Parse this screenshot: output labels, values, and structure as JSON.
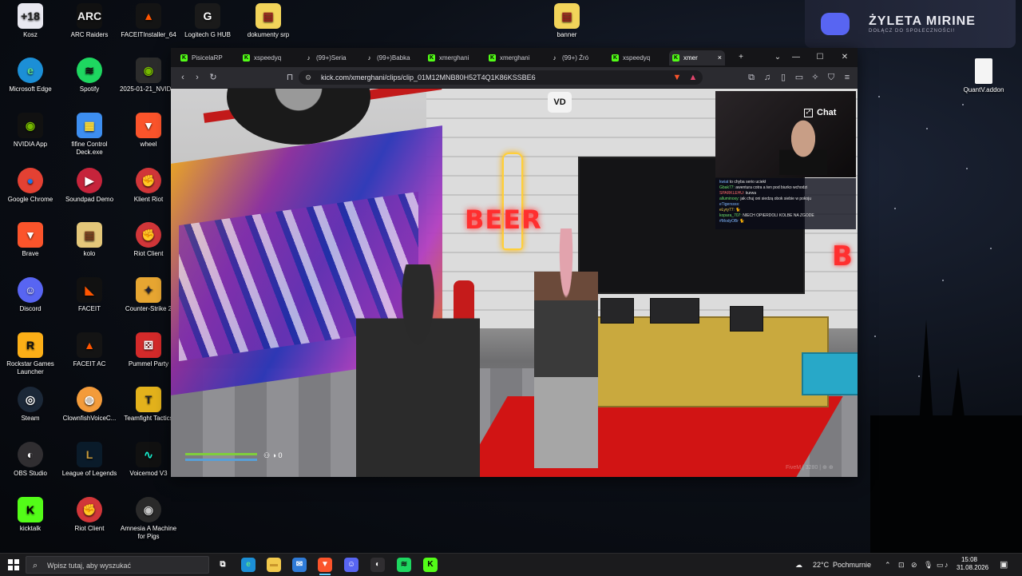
{
  "desktop": {
    "icons": [
      {
        "label": "Kosz",
        "icon": "recycle-bin-icon",
        "glyph": "+18",
        "bg": "#e8e8f0",
        "fg": "#222"
      },
      {
        "label": "ARC Raiders",
        "icon": "arc-raiders-icon",
        "glyph": "ARC",
        "bg": "#111",
        "fg": "#f0f0f0"
      },
      {
        "label": "FACEITInstaller_64",
        "icon": "faceit-installer-icon",
        "glyph": "▲",
        "bg": "#141414",
        "fg": "#ff5500"
      },
      {
        "label": "Logitech G HUB",
        "icon": "logitech-icon",
        "glyph": "G",
        "bg": "#1a1a1a",
        "fg": "#fff"
      },
      {
        "label": "dokumenty srp",
        "icon": "archive-icon",
        "glyph": "▤",
        "bg": "#f2d45a",
        "fg": "#9b1d1d"
      },
      {
        "label": "banner",
        "icon": "archive-icon",
        "glyph": "▤",
        "bg": "#f2d45a",
        "fg": "#9b1d1d"
      },
      {
        "label": "Microsoft Edge",
        "icon": "edge-icon",
        "glyph": "e",
        "bg": "#1c8fd6",
        "fg": "#5ee08a"
      },
      {
        "label": "Spotify",
        "icon": "spotify-icon",
        "glyph": "≋",
        "bg": "#1ed760",
        "fg": "#111"
      },
      {
        "label": "2025-01-21_NVIDIA",
        "icon": "nvidia-file-icon",
        "glyph": "◉",
        "bg": "#2c2c2c",
        "fg": "#76b900"
      },
      {
        "label": "NVIDIA App",
        "icon": "nvidia-icon",
        "glyph": "◉",
        "bg": "#111",
        "fg": "#76b900"
      },
      {
        "label": "fifine Control Deck.exe",
        "icon": "control-deck-icon",
        "glyph": "▦",
        "bg": "#3d8ef0",
        "fg": "#ffde3b"
      },
      {
        "label": "wheel",
        "icon": "brave-icon",
        "glyph": "▼",
        "bg": "#fb542b",
        "fg": "#fff"
      },
      {
        "label": "Google Chrome",
        "icon": "chrome-icon",
        "glyph": "●",
        "bg": "#e34133",
        "fg": "#1a73e8"
      },
      {
        "label": "Soundpad Demo",
        "icon": "soundpad-icon",
        "glyph": "▶",
        "bg": "#c6243b",
        "fg": "#fff"
      },
      {
        "label": "Klient Riot",
        "icon": "riot-icon",
        "glyph": "✊",
        "bg": "#d13639",
        "fg": "#fff"
      },
      {
        "label": "Brave",
        "icon": "brave-icon",
        "glyph": "▼",
        "bg": "#fb542b",
        "fg": "#fff"
      },
      {
        "label": "kolo",
        "icon": "archive-icon",
        "glyph": "▤",
        "bg": "#e4c77a",
        "fg": "#7a3b1a"
      },
      {
        "label": "Riot Client",
        "icon": "riot-icon",
        "glyph": "✊",
        "bg": "#d13639",
        "fg": "#fff"
      },
      {
        "label": "Discord",
        "icon": "discord-icon",
        "glyph": "☺",
        "bg": "#5865f2",
        "fg": "#fff"
      },
      {
        "label": "FACEIT",
        "icon": "faceit-icon",
        "glyph": "◣",
        "bg": "#111",
        "fg": "#ff5500"
      },
      {
        "label": "Counter-Strike 2",
        "icon": "cs2-icon",
        "glyph": "✦",
        "bg": "#e7a632",
        "fg": "#223"
      },
      {
        "label": "Rockstar Games Launcher",
        "icon": "rockstar-icon",
        "glyph": "R",
        "bg": "#fcaf17",
        "fg": "#111"
      },
      {
        "label": "FACEIT AC",
        "icon": "faceit-ac-icon",
        "glyph": "▲",
        "bg": "#141414",
        "fg": "#ff5500"
      },
      {
        "label": "Pummel Party",
        "icon": "pummel-party-icon",
        "glyph": "⚄",
        "bg": "#d42a2a",
        "fg": "#fff"
      },
      {
        "label": "Steam",
        "icon": "steam-icon",
        "glyph": "◎",
        "bg": "#1b2838",
        "fg": "#fff"
      },
      {
        "label": "ClownfishVoiceC...",
        "icon": "clownfish-icon",
        "glyph": "◍",
        "bg": "#f39b3a",
        "fg": "#fff"
      },
      {
        "label": "Teamfight Tactics",
        "icon": "tft-icon",
        "glyph": "T",
        "bg": "#e3b21c",
        "fg": "#222"
      },
      {
        "label": "OBS Studio",
        "icon": "obs-icon",
        "glyph": "◐",
        "bg": "#302e31",
        "fg": "#fff"
      },
      {
        "label": "League of Legends",
        "icon": "lol-icon",
        "glyph": "L",
        "bg": "#0a1b2a",
        "fg": "#c89b3c"
      },
      {
        "label": "Voicemod V3",
        "icon": "voicemod-icon",
        "glyph": "∿",
        "bg": "#111",
        "fg": "#19f0d0"
      },
      {
        "label": "kicktalk",
        "icon": "kicktalk-icon",
        "glyph": "K",
        "bg": "#53fc18",
        "fg": "#000"
      },
      {
        "label": "Riot Client",
        "icon": "riot-icon",
        "glyph": "✊",
        "bg": "#d13639",
        "fg": "#fff"
      },
      {
        "label": "Amnesia A Machine for Pigs",
        "icon": "amnesia-icon",
        "glyph": "◉",
        "bg": "#2a2a2a",
        "fg": "#c8c8c8"
      },
      {
        "label": "QuantV.addon",
        "icon": "file-icon",
        "glyph": "",
        "bg": "#f4f4f4",
        "fg": "#999"
      }
    ]
  },
  "discord_banner": {
    "title": "ŻYLETA MIRINE",
    "subtitle": "DOŁĄCZ DO SPOŁECZNOŚCI!"
  },
  "browser": {
    "tabs": [
      {
        "label": "PisicelaRP",
        "fav": "kick"
      },
      {
        "label": "xspeedyq",
        "fav": "kick"
      },
      {
        "label": "(99+)Seria",
        "fav": "tiktok"
      },
      {
        "label": "(99+)Babka",
        "fav": "tiktok"
      },
      {
        "label": "xmerghani",
        "fav": "kick"
      },
      {
        "label": "xmerghani",
        "fav": "kick"
      },
      {
        "label": "(99+) Źró",
        "fav": "tiktok"
      },
      {
        "label": "xspeedyq",
        "fav": "kick"
      },
      {
        "label": "xmer",
        "fav": "kick"
      }
    ],
    "url": "kick.com/xmerghani/clips/clip_01M12MNB80H52T4Q1K86KSSBE6",
    "new_tab": "+",
    "close_tab": "×"
  },
  "video": {
    "sign_text": "BEER",
    "right_sign": "B",
    "logo": "VD",
    "chat_button": "Chat",
    "hud_value": "0",
    "watermark": "FiveM | 3280 | ⊕ ⊕",
    "chat_messages": [
      {
        "name": "kwiat",
        "text": "to chyba serio uciekł",
        "color": "nm3"
      },
      {
        "name": "Gbak77:",
        "text": "awentura cotra a ten pod biurko wchodzi",
        "color": "nm1"
      },
      {
        "name": "SPARKLEHU:",
        "text": "kurwa",
        "color": "nm2"
      },
      {
        "name": "alluminoxy:",
        "text": "jak chuj oni siedzą obok siebie w pokoju",
        "color": "nm1"
      },
      {
        "name": "eTigerssss:",
        "text": "",
        "color": "nm3"
      },
      {
        "name": "eLyry77:",
        "text": "🐈",
        "color": "nm4"
      },
      {
        "name": "kopara_707:",
        "text": "NIECH OPIERDOLI KOLBE NA ZGODE",
        "color": "nm1"
      },
      {
        "name": "#ModyOBr",
        "text": "🐈",
        "color": "nm3"
      }
    ]
  },
  "taskbar": {
    "search_placeholder": "Wpisz tutaj, aby wyszukać",
    "weather_temp": "22°C",
    "weather_desc": "Pochmurnie",
    "time": "15:08",
    "date": "31.08.2026",
    "apps": [
      {
        "name": "task-view-icon",
        "glyph": "⧉",
        "bg": "transparent",
        "fg": "#fff"
      },
      {
        "name": "edge-icon",
        "glyph": "e",
        "bg": "#1c8fd6",
        "fg": "#5ee08a"
      },
      {
        "name": "file-explorer-icon",
        "glyph": "▬",
        "bg": "#f2c94c",
        "fg": "#c9952b"
      },
      {
        "name": "mail-icon",
        "glyph": "✉",
        "bg": "#2f7bd8",
        "fg": "#fff"
      },
      {
        "name": "brave-icon",
        "glyph": "▼",
        "bg": "#fb542b",
        "fg": "#fff"
      },
      {
        "name": "discord-icon",
        "glyph": "☺",
        "bg": "#5865f2",
        "fg": "#fff"
      },
      {
        "name": "obs-icon",
        "glyph": "◐",
        "bg": "#302e31",
        "fg": "#fff"
      },
      {
        "name": "spotify-icon",
        "glyph": "≋",
        "bg": "#1ed760",
        "fg": "#111"
      },
      {
        "name": "kicktalk-icon",
        "glyph": "K",
        "bg": "#53fc18",
        "fg": "#000"
      }
    ]
  },
  "colors": {
    "kick_green": "#53fc18",
    "taskbar": "#1b1b1d",
    "browser_chrome": "#2b2b30"
  }
}
